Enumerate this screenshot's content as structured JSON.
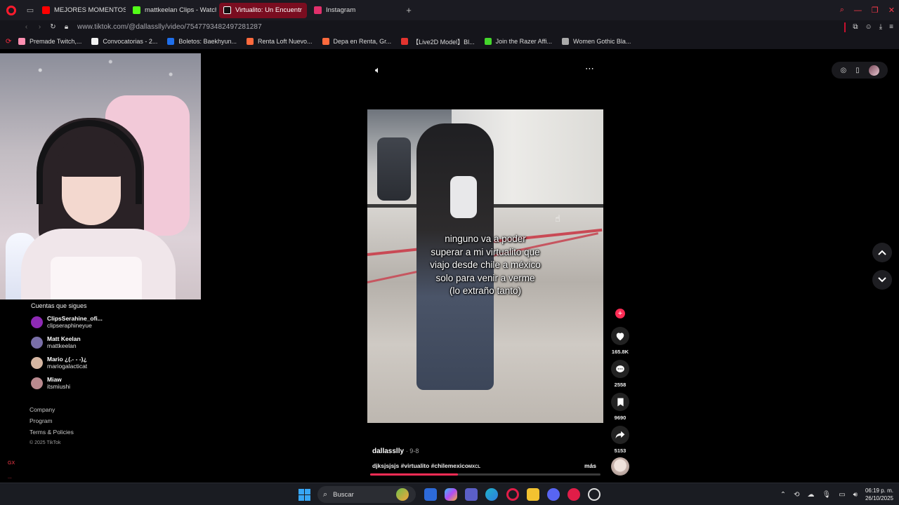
{
  "browser": {
    "tabs": [
      {
        "label": "MEJORES MOMENTOS DE",
        "color": "#ff0000",
        "active": false
      },
      {
        "label": "mattkeelan Clips - Watch",
        "color": "#53fc18",
        "active": false
      },
      {
        "label": "Virtualito: Un Encuentr",
        "color": "#111111",
        "active": true
      },
      {
        "label": "Instagram",
        "color": "#e1306c",
        "active": false
      }
    ],
    "new_tab": "+",
    "url": "www.tiktok.com/@dallasslly/video/7547793482497281287",
    "bookmarks": [
      {
        "label": "Premade Twitch,...",
        "color": "#ff8fb1"
      },
      {
        "label": "Convocatorias - 2...",
        "color": "#f2f2f2"
      },
      {
        "label": "Boletos: Baekhyun...",
        "color": "#1f6feb"
      },
      {
        "label": "Renta Loft Nuevo...",
        "color": "#ff6a3d"
      },
      {
        "label": "Depa en Renta, Gr...",
        "color": "#ff6a3d"
      },
      {
        "label": "【Live2D Model】Bl...",
        "color": "#e3342f"
      },
      {
        "label": "Join the Razer Affi...",
        "color": "#44d62c"
      },
      {
        "label": "Women Gothic Bla...",
        "color": "#aaaaaa"
      }
    ]
  },
  "sidebar": {
    "following_title": "Cuentas que sigues",
    "accounts": [
      {
        "name": "ClipsSerahine_ofi...",
        "handle": "clipseraphineyue",
        "color": "#8e2ab5"
      },
      {
        "name": "Matt Keelan",
        "handle": "mattkeelan",
        "color": "#7a6fa8"
      },
      {
        "name": "Mario ¿(.- - -)¿",
        "handle": "mariogalacticat",
        "color": "#d6b7a3"
      },
      {
        "name": "Miaw",
        "handle": "itsmiushi",
        "color": "#b98a8f"
      }
    ],
    "footer": {
      "company": "Company",
      "program": "Program",
      "terms": "Terms & Policies",
      "copyright": "© 2025 TikTok"
    },
    "mini": [
      "GX",
      "..."
    ]
  },
  "video": {
    "caption_lines": [
      "ninguno va a poder",
      "superar a mi virtualito que",
      "viajo desde chile a méxico",
      "solo para venir a verme",
      "(lo extraño tanto)"
    ],
    "author": "dallasslly",
    "date": "· 9-8",
    "description": "djksjsjsjs #virtualito #chilemexico",
    "description_suffix": "MXCL",
    "more_label": "más",
    "progress": 0.38
  },
  "actions": {
    "likes": "165.8K",
    "comments": "2558",
    "bookmarks": "9690",
    "shares": "5153"
  },
  "taskbar": {
    "search_placeholder": "Buscar",
    "time": "06:19 p. m.",
    "date": "26/10/2025"
  }
}
